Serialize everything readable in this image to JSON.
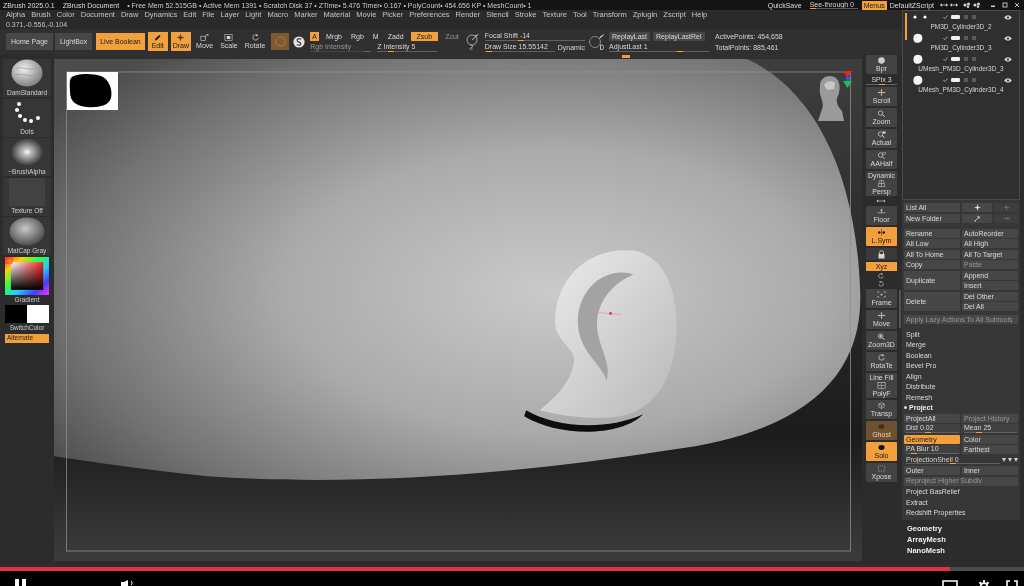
{
  "title_bar": {
    "app": "ZBrush 2025.0.1",
    "document": "ZBrush Document",
    "stats": "• Free Mem 52.515GB • Active Mem 1391 • Scratch Disk 37 • ZTime• 5.476 Timer• 0.167 • PolyCount• 454.656 KP • MeshCount• 1",
    "quick_save": "QuickSave",
    "see_through": {
      "label": "See-through 0",
      "level": 0
    },
    "menus": {
      "label": "Menus",
      "on": true
    },
    "script": "DefaultZScript"
  },
  "menu_bar": [
    "Alpha",
    "Brush",
    "Color",
    "Document",
    "Draw",
    "Dynamics",
    "Edit",
    "File",
    "Layer",
    "Light",
    "Macro",
    "Marker",
    "Material",
    "Movie",
    "Picker",
    "Preferences",
    "Render",
    "Stencil",
    "Stroke",
    "Texture",
    "Tool",
    "Transform",
    "Zplugin",
    "Zscript",
    "Help"
  ],
  "coordinates": "0.371,-0.556,-0.104",
  "toolbar": {
    "nav": [
      "Home Page",
      "LightBox"
    ],
    "live_boolean": {
      "label": "Live Boolean",
      "on": true
    },
    "modes": [
      {
        "label": "Edit",
        "on": true
      },
      {
        "label": "Draw",
        "on": true
      },
      {
        "label": "Move",
        "on": false
      },
      {
        "label": "Scale",
        "on": false
      },
      {
        "label": "Rotate",
        "on": false
      }
    ],
    "circle_toggle": {
      "on": true
    },
    "channels": [
      {
        "label": "A",
        "on": true,
        "disabled": false
      },
      {
        "label": "Mrgb",
        "on": false,
        "disabled": false
      },
      {
        "label": "Rgb",
        "on": false,
        "disabled": false
      },
      {
        "label": "M",
        "on": false,
        "disabled": false
      },
      {
        "label": "Zadd",
        "on": false,
        "disabled": false
      },
      {
        "label": "Zsub",
        "on": true,
        "disabled": false
      },
      {
        "label": "Zcut",
        "on": false,
        "disabled": true
      }
    ],
    "rgb_intensity": {
      "label": "Rgb Intensity",
      "level": 0.95,
      "disabled": true
    },
    "z_intensity": {
      "label": "Z Intensity 5",
      "level": 0.2,
      "disabled": false
    },
    "focal_shift": {
      "label": "Focal Shift -14",
      "level": 0.35,
      "disabled": false
    },
    "draw_size": {
      "label": "Draw Size 15.55142",
      "level": 0.02,
      "disabled": false
    },
    "dynamic": "Dynamic",
    "replay": [
      "ReplayLast",
      "ReplayLastRel"
    ],
    "adjust_last": {
      "label": "AdjustLast 1",
      "level": 0.72,
      "disabled": false
    },
    "active_points": "ActivePoints: 454,658",
    "total_points": "TotalPoints: 885,461"
  },
  "left_shelf": {
    "items": [
      {
        "kind": "brush",
        "label": "DamStandard"
      },
      {
        "kind": "stroke",
        "label": "Dots"
      },
      {
        "kind": "alpha",
        "label": "~BrushAlpha"
      },
      {
        "kind": "texture",
        "label": "Texture Off"
      },
      {
        "kind": "material",
        "label": "MatCap Gray"
      }
    ],
    "gradient": "Gradient",
    "swatches": [
      {
        "color": "#000000"
      },
      {
        "color": "#ffffff"
      }
    ],
    "switch_color": "SwitchColor",
    "alternate": {
      "label": "Alternate",
      "on": true
    }
  },
  "view_tools": [
    {
      "kind": "button",
      "label": "Bpr",
      "on": false,
      "disabled": false
    },
    {
      "kind": "slider",
      "label": "SPix 3",
      "level": 0.5
    },
    {
      "kind": "button",
      "label": "Scroll",
      "on": false,
      "disabled": false
    },
    {
      "kind": "button",
      "label": "Zoom",
      "on": false,
      "disabled": false
    },
    {
      "kind": "button",
      "label": "Actual",
      "on": false,
      "disabled": false
    },
    {
      "kind": "button",
      "label": "AAHalf",
      "on": false,
      "disabled": false
    },
    {
      "kind": "button",
      "label": "Persp",
      "caption": "Dynamic",
      "on": false,
      "disabled": false
    },
    {
      "kind": "mini"
    },
    {
      "kind": "button",
      "label": "Floor",
      "on": false,
      "disabled": false
    },
    {
      "kind": "button",
      "label": "L.Sym",
      "on": true,
      "disabled": false
    },
    {
      "kind": "icon_only",
      "on": false
    },
    {
      "kind": "small",
      "label": "Xyz",
      "on": true
    },
    {
      "kind": "mini"
    },
    {
      "kind": "mini"
    },
    {
      "kind": "button",
      "label": "Frame",
      "on": false,
      "disabled": false
    },
    {
      "kind": "button",
      "label": "Move",
      "on": false,
      "disabled": false
    },
    {
      "kind": "button",
      "label": "Zoom3D",
      "on": false,
      "disabled": false
    },
    {
      "kind": "button",
      "label": "RotaTe",
      "on": false,
      "disabled": false
    },
    {
      "kind": "button",
      "label": "PolyF",
      "caption": "Line Fill",
      "on": false,
      "disabled": false
    },
    {
      "kind": "button",
      "label": "Transp",
      "on": false,
      "disabled": false
    },
    {
      "kind": "button",
      "label": "Ghost",
      "on": true,
      "disabled": true
    },
    {
      "kind": "button",
      "label": "Solo",
      "on": true,
      "disabled": false
    },
    {
      "kind": "button",
      "label": "Xpose",
      "on": false,
      "disabled": false
    }
  ],
  "subtool_panel": {
    "subtools": [
      {
        "kind": "dots",
        "name": "PM3D_Cylinder3D_2"
      },
      {
        "kind": "blob",
        "name": "PM3D_Cylinder3D_3"
      },
      {
        "kind": "blob",
        "name": "UMesh_PM3D_Cylinder3D_3"
      },
      {
        "kind": "blob",
        "name": "UMesh_PM3D_Cylinder3D_4"
      }
    ],
    "rows": [
      {
        "kind": "icon_pair",
        "label": "List All"
      },
      {
        "kind": "icon_pair",
        "label": "New Folder"
      },
      {
        "kind": "pair",
        "cells": [
          {
            "label": "Rename",
            "on": false,
            "disabled": false
          },
          {
            "label": "AutoReorder",
            "on": false,
            "disabled": false
          }
        ]
      },
      {
        "kind": "pair",
        "cells": [
          {
            "label": "All Low",
            "on": false,
            "disabled": false
          },
          {
            "label": "All High",
            "on": false,
            "disabled": false
          }
        ]
      },
      {
        "kind": "pair",
        "cells": [
          {
            "label": "All To Home",
            "on": false,
            "disabled": false
          },
          {
            "label": "All To Target",
            "on": false,
            "disabled": false
          }
        ]
      },
      {
        "kind": "pair",
        "cells": [
          {
            "label": "Copy",
            "on": false,
            "disabled": false
          },
          {
            "label": "Paste",
            "on": false,
            "disabled": true
          }
        ]
      },
      {
        "kind": "split",
        "label": "Duplicate",
        "cells": [
          {
            "label": "Append",
            "on": false,
            "disabled": false
          },
          {
            "label": "Insert",
            "on": false,
            "disabled": false
          }
        ]
      },
      {
        "kind": "split",
        "label": "Delete",
        "cells": [
          {
            "label": "Del Other",
            "on": false,
            "disabled": false
          },
          {
            "label": "Del All",
            "on": false,
            "disabled": false
          }
        ]
      },
      {
        "kind": "full",
        "label": "Apply Lazy Actions To All Subtools",
        "disabled": true
      },
      {
        "kind": "item",
        "label": "Split"
      },
      {
        "kind": "item",
        "label": "Merge"
      },
      {
        "kind": "item",
        "label": "Boolean"
      },
      {
        "kind": "item",
        "label": "Bevel Pro"
      },
      {
        "kind": "item",
        "label": "Align"
      },
      {
        "kind": "item",
        "label": "Distribute"
      },
      {
        "kind": "item",
        "label": "Remesh"
      },
      {
        "kind": "section",
        "label": "Project"
      },
      {
        "kind": "pair",
        "cells": [
          {
            "kind": "button",
            "label": "ProjectAll",
            "on": false,
            "disabled": false
          },
          {
            "kind": "button",
            "label": "Project History",
            "on": false,
            "disabled": true
          }
        ]
      },
      {
        "kind": "pair",
        "cells": [
          {
            "kind": "slider",
            "label": "Dist 0.02",
            "level": 0.4
          },
          {
            "kind": "slider",
            "label": "Mean 25",
            "level": 0.25
          }
        ]
      },
      {
        "kind": "pair",
        "cells": [
          {
            "kind": "button",
            "label": "Geometry",
            "on": true,
            "disabled": false
          },
          {
            "kind": "button",
            "label": "Color",
            "on": false,
            "disabled": false
          }
        ]
      },
      {
        "kind": "pair",
        "cells": [
          {
            "kind": "slider",
            "label": "PA Blur 10",
            "level": 0.1
          },
          {
            "kind": "button",
            "label": "Farthest",
            "on": false,
            "disabled": false
          }
        ]
      },
      {
        "kind": "wide_slider",
        "label": "ProjectionShell 0",
        "level": 0.5
      },
      {
        "kind": "pair",
        "cells": [
          {
            "kind": "button",
            "label": "Outer",
            "on": false,
            "disabled": false
          },
          {
            "kind": "button",
            "label": "Inner",
            "on": false,
            "disabled": false
          }
        ]
      },
      {
        "kind": "full",
        "label": "Reproject Higher Subdiv",
        "disabled": true
      },
      {
        "kind": "item",
        "label": "Project BasRelief"
      },
      {
        "kind": "item",
        "label": "Extract"
      },
      {
        "kind": "item",
        "label": "Redshift Properties"
      }
    ],
    "palettes": [
      "Geometry",
      "ArrayMesh",
      "NanoMesh"
    ]
  },
  "video_player": {
    "progress": {
      "level": 0.928
    }
  }
}
